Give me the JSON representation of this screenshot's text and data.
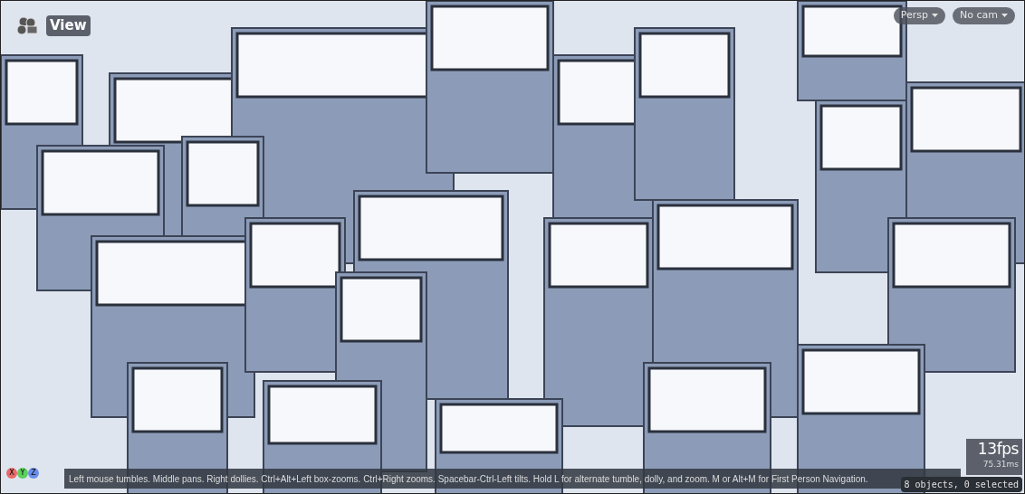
{
  "viewport": {
    "title": "View",
    "menus": [
      {
        "label": "Persp"
      },
      {
        "label": "No cam"
      }
    ],
    "axes": [
      {
        "label": "X",
        "color": "#e86a6a"
      },
      {
        "label": "Y",
        "color": "#5ccf5c"
      },
      {
        "label": "Z",
        "color": "#6a8ee8"
      }
    ],
    "hint": "Left mouse tumbles. Middle pans. Right dollies. Ctrl+Alt+Left box-zooms. Ctrl+Right zooms. Spacebar-Ctrl-Left tilts. Hold L for alternate tumble, dolly, and zoom. M or Alt+M for First Person Navigation.",
    "selection": "8 objects, 0 selected",
    "fps": "13fps",
    "frame_time": "75.31ms"
  }
}
